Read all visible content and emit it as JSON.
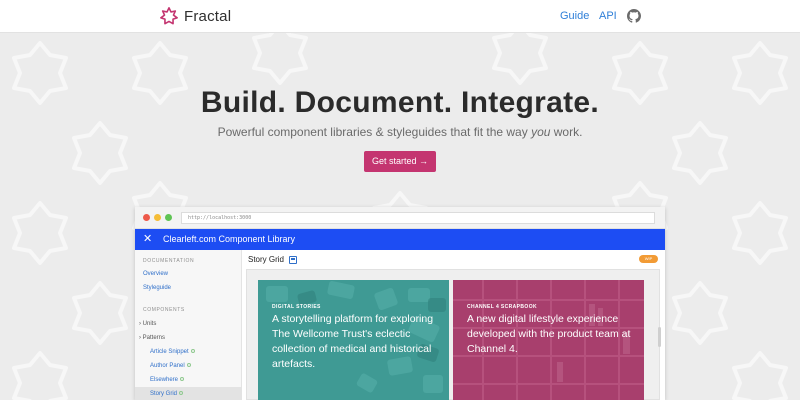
{
  "nav": {
    "brand": "Fractal",
    "links": [
      {
        "label": "Guide"
      },
      {
        "label": "API"
      }
    ],
    "github_icon": "github-icon"
  },
  "hero": {
    "title": "Build. Document. Integrate.",
    "subtitle_before": "Powerful component libraries & styleguides that fit the way ",
    "subtitle_emphasis": "you",
    "subtitle_after": " work.",
    "cta_label": "Get started →"
  },
  "browser": {
    "url": "http://localhost:3000",
    "app_title": "Clearleft.com Component Library",
    "close_icon": "close-icon",
    "sidebar": {
      "documentation_heading": "DOCUMENTATION",
      "documentation_links": [
        "Overview",
        "Styleguide"
      ],
      "components_heading": "COMPONENTS",
      "groups": [
        {
          "label": "Units",
          "expanded": false
        },
        {
          "label": "Patterns",
          "expanded": true
        }
      ],
      "pattern_items": [
        "Article Snippet",
        "Author Panel",
        "Elsewhere",
        "Story Grid"
      ]
    },
    "main": {
      "title": "Story Grid",
      "status_badge": "WIP",
      "cards": [
        {
          "eyebrow": "DIGITAL STORIES",
          "text": "A storytelling platform for exploring The Wellcome Trust's eclectic collection of medical and historical artefacts.",
          "color": "#3f9a94"
        },
        {
          "eyebrow": "CHANNEL 4 SCRAPBOOK",
          "text": "A new digital lifestyle experience developed with the product team at Channel 4.",
          "color": "#a83f6d"
        }
      ]
    }
  },
  "colors": {
    "accent": "#c43570",
    "app_bar": "#1d4df3",
    "link": "#2f7fd8",
    "hero_bg": "#ececec"
  }
}
